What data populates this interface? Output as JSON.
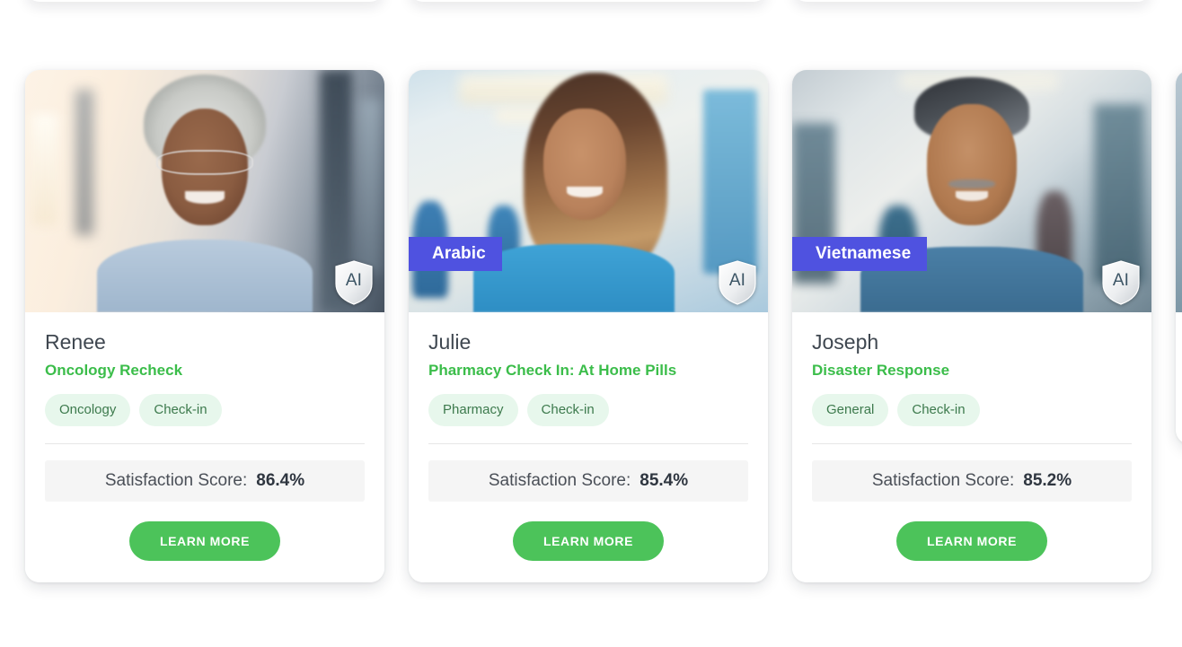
{
  "theme": {
    "page_background": "#ffffff",
    "accent_green": "#3bbd4a",
    "button_green": "#4cc35a",
    "tag_background": "#e7f7ec",
    "tag_text": "#3d7a4d",
    "language_badge_purple": "#4f52e0",
    "score_bar_background": "#f5f5f5",
    "name_text": "#3f4750"
  },
  "labels": {
    "score_label": "Satisfaction Score:",
    "cta_label": "LEARN MORE",
    "ai_badge_text": "AI"
  },
  "icons": {
    "ai_shield": "ai-shield-icon"
  },
  "cards": [
    {
      "name": "Renee",
      "topic": "Oncology Recheck",
      "language": null,
      "ai_badge": "AI",
      "tags": [
        "Oncology",
        "Check-in"
      ],
      "score_label": "Satisfaction Score:",
      "score_value": "86.4%",
      "cta_label": "LEARN MORE",
      "photo_alt": "smiling senior woman in light blue scrubs in a sunlit hospital corridor"
    },
    {
      "name": "Julie",
      "topic": "Pharmacy Check In: At Home Pills",
      "language": "Arabic",
      "ai_badge": "AI",
      "tags": [
        "Pharmacy",
        "Check-in"
      ],
      "score_label": "Satisfaction Score:",
      "score_value": "85.4%",
      "cta_label": "LEARN MORE",
      "photo_alt": "smiling woman with long highlighted hair in blue scrubs in a hospital hallway"
    },
    {
      "name": "Joseph",
      "topic": "Disaster Response",
      "language": "Vietnamese",
      "ai_badge": "AI",
      "tags": [
        "General",
        "Check-in"
      ],
      "score_label": "Satisfaction Score:",
      "score_value": "85.2%",
      "cta_label": "LEARN MORE",
      "photo_alt": "smiling middle-aged man with gray hair and moustache in blue scrubs"
    },
    {
      "name": "",
      "topic": "",
      "language": null,
      "ai_badge": "",
      "tags": [],
      "score_label": "",
      "score_value": "",
      "cta_label": "",
      "photo_alt": "partially visible fourth card at the right edge"
    }
  ]
}
